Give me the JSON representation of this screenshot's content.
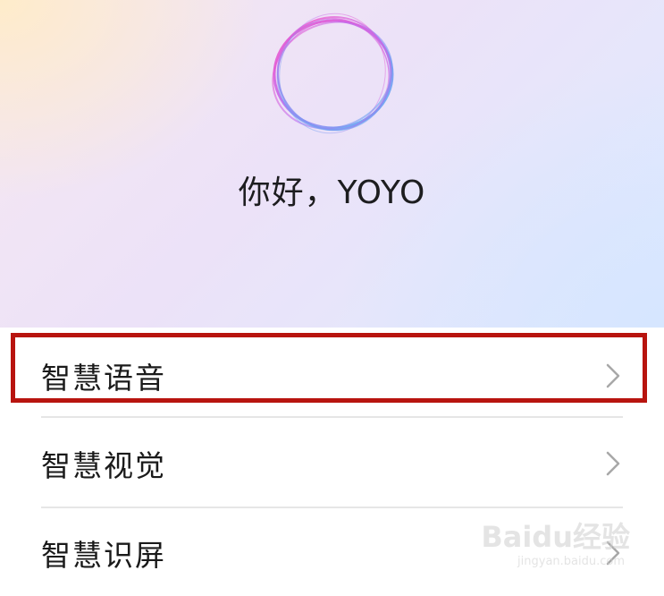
{
  "assistant": {
    "greeting": "你好，YOYO",
    "orb_icon": "voice-assistant-orb-icon"
  },
  "menu": {
    "items": [
      {
        "label": "智慧语音",
        "icon": "chevron-right-icon",
        "highlighted": true
      },
      {
        "label": "智慧视觉",
        "icon": "chevron-right-icon",
        "highlighted": false
      },
      {
        "label": "智慧识屏",
        "icon": "chevron-right-icon",
        "highlighted": false
      }
    ]
  },
  "watermark": {
    "brand": "Baidu经验",
    "url": "jingyan.baidu.com"
  },
  "colors": {
    "highlight_border": "#b8140f",
    "orb_pink": "#ee4fc3",
    "orb_blue": "#53b8f0",
    "orb_purple": "#9b6ef0",
    "text_primary": "#1a1a1a"
  }
}
